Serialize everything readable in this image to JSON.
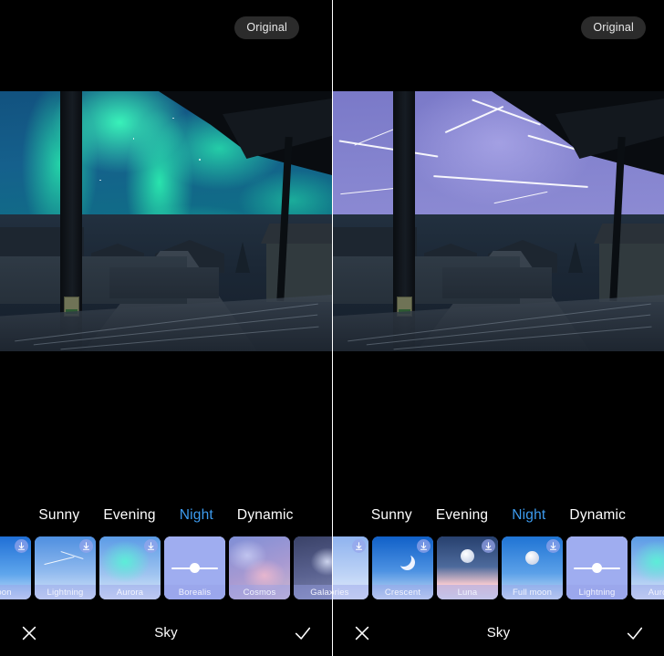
{
  "app": {
    "title": "Sky",
    "accent_color": "#3d9cf0",
    "background": "#000000"
  },
  "panels": [
    {
      "id": "left",
      "badge": "Original",
      "photo": {
        "scene": "village-street-at-night",
        "sky_preset": "Aurora borealis green sky",
        "description": "Dashcam view down a village street with brick wall, houses and a utility pole; green aurora fills the sky"
      },
      "tabs": [
        {
          "label": "Sunny",
          "active": false
        },
        {
          "label": "Evening",
          "active": false
        },
        {
          "label": "Night",
          "active": true
        },
        {
          "label": "Dynamic",
          "active": false
        }
      ],
      "thumbnails": [
        {
          "label": "moon",
          "partial": true,
          "selected": false,
          "downloadable": true,
          "art": "moon"
        },
        {
          "label": "Lightning",
          "partial": false,
          "selected": false,
          "downloadable": true,
          "art": "lightning"
        },
        {
          "label": "Aurora",
          "partial": false,
          "selected": false,
          "downloadable": true,
          "art": "aurora"
        },
        {
          "label": "Borealis",
          "partial": false,
          "selected": true,
          "downloadable": false,
          "art": "slider"
        },
        {
          "label": "Cosmos",
          "partial": false,
          "selected": false,
          "downloadable": false,
          "art": "cosmos"
        },
        {
          "label": "Galaxy",
          "partial": true,
          "selected": false,
          "downloadable": false,
          "art": "galaxy"
        }
      ],
      "bottom_bar": {
        "cancel_icon": "close-icon",
        "title": "Sky",
        "confirm_icon": "check-icon"
      }
    },
    {
      "id": "right",
      "badge": "Original",
      "photo": {
        "scene": "village-street-at-night",
        "sky_preset": "Purple storm sky with lightning bolts",
        "description": "Same dashcam view down a village street; violet storm sky crossed by forked lightning"
      },
      "tabs": [
        {
          "label": "Sunny",
          "active": false
        },
        {
          "label": "Evening",
          "active": false
        },
        {
          "label": "Night",
          "active": true
        },
        {
          "label": "Dynamic",
          "active": false
        }
      ],
      "thumbnails": [
        {
          "label": "tories",
          "partial": true,
          "selected": false,
          "downloadable": true,
          "art": "stories"
        },
        {
          "label": "Crescent",
          "partial": false,
          "selected": false,
          "downloadable": true,
          "art": "crescent"
        },
        {
          "label": "Luna",
          "partial": false,
          "selected": false,
          "downloadable": true,
          "art": "luna"
        },
        {
          "label": "Full moon",
          "partial": false,
          "selected": false,
          "downloadable": true,
          "art": "fullmoon"
        },
        {
          "label": "Lightning",
          "partial": false,
          "selected": true,
          "downloadable": false,
          "art": "slider"
        },
        {
          "label": "Aurora",
          "partial": true,
          "selected": false,
          "downloadable": false,
          "art": "aurora"
        }
      ],
      "bottom_bar": {
        "cancel_icon": "close-icon",
        "title": "Sky",
        "confirm_icon": "check-icon"
      }
    }
  ]
}
